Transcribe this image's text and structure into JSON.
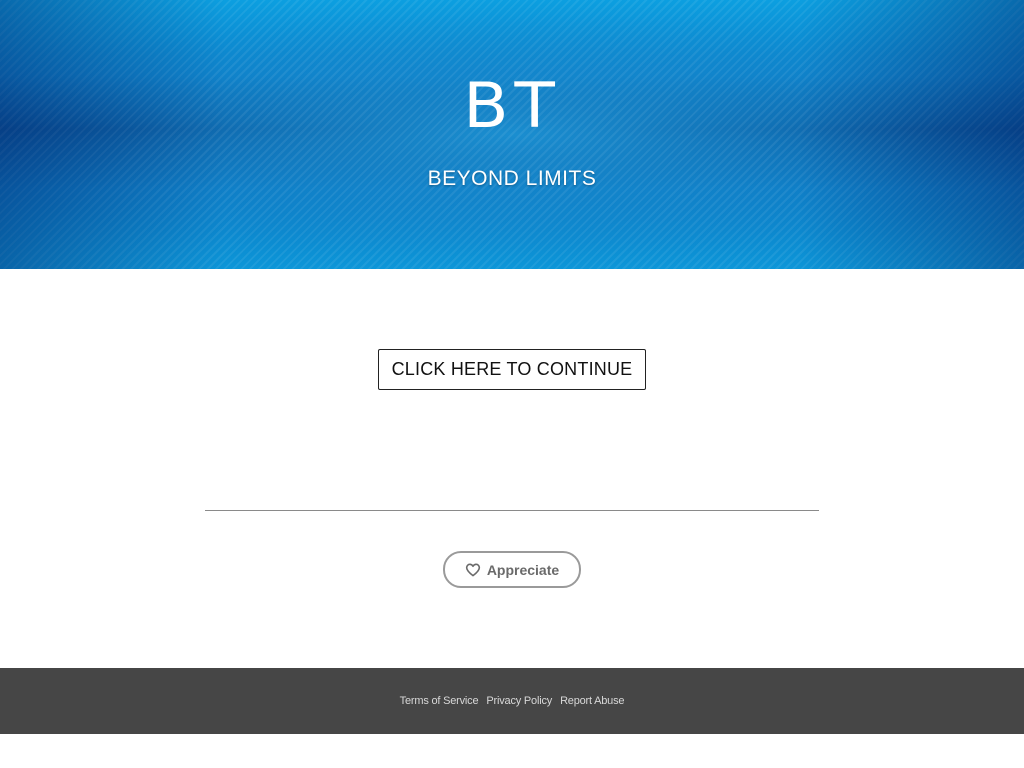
{
  "hero": {
    "title": "BT",
    "subtitle": "BEYOND LIMITS"
  },
  "main": {
    "cta_label": "CLICK HERE TO CONTINUE",
    "appreciate_label": "Appreciate",
    "appreciate_icon": "heart-outline-icon"
  },
  "footer": {
    "links": [
      {
        "label": "Terms of Service"
      },
      {
        "label": "Privacy Policy"
      },
      {
        "label": "Report Abuse"
      }
    ]
  },
  "colors": {
    "hero_blue": "#0b7ec8",
    "footer_bg": "#464646"
  }
}
